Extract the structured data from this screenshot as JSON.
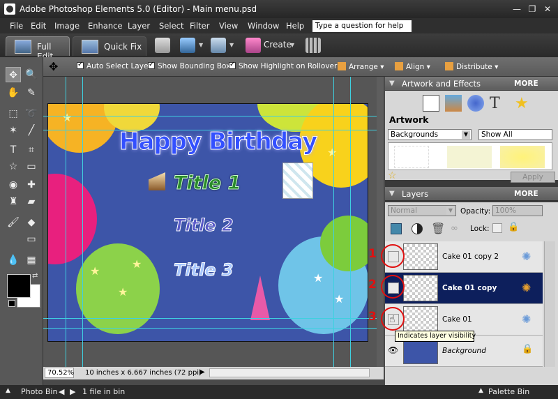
{
  "window": {
    "title": "Adobe Photoshop Elements 5.0 (Editor) - Main menu.psd",
    "minimize": "—",
    "restore": "❐",
    "close": "✕"
  },
  "menu": {
    "items": [
      "File",
      "Edit",
      "Image",
      "Enhance",
      "Layer",
      "Select",
      "Filter",
      "View",
      "Window",
      "Help"
    ],
    "help_placeholder": "Type a question for help"
  },
  "mode_tabs": {
    "full_edit": "Full Edit",
    "quick_fix": "Quick Fix"
  },
  "toolbar": {
    "create_label": "Create"
  },
  "options": {
    "auto_select": "Auto Select Layer",
    "bounding_box": "Show Bounding Box",
    "highlight": "Show Highlight on Rollover",
    "arrange": "Arrange",
    "align": "Align",
    "distribute": "Distribute"
  },
  "canvas": {
    "heading": "Happy Birthday",
    "title1": "Title 1",
    "title2": "Title 2",
    "title3": "Title 3"
  },
  "status": {
    "zoom": "70.52%",
    "doc_info": "10 inches x 6.667 inches (72 ppi)"
  },
  "bottom": {
    "photo_bin": "Photo Bin",
    "file_count": "1 file in bin",
    "palette_bin": "Palette Bin"
  },
  "artwork_effects": {
    "header": "Artwork and Effects",
    "more": "MORE",
    "section": "Artwork",
    "category": "Backgrounds",
    "filter": "Show All",
    "apply": "Apply"
  },
  "layers": {
    "header": "Layers",
    "more": "MORE",
    "blend_mode": "Normal",
    "opacity_label": "Opacity:",
    "opacity": "100%",
    "lock_label": "Lock:",
    "rows": [
      {
        "name": "Cake 01 copy 2",
        "selected": false
      },
      {
        "name": "Cake 01 copy",
        "selected": true
      },
      {
        "name": "Cake 01",
        "selected": false
      },
      {
        "name": "Background",
        "selected": false
      }
    ],
    "tooltip": "Indicates layer visibility"
  },
  "annotations": [
    "1",
    "2",
    "3"
  ],
  "colors": {
    "accent_red": "#e01010",
    "selected_layer": "#0d1f5c",
    "guide": "#3fd0e0"
  }
}
